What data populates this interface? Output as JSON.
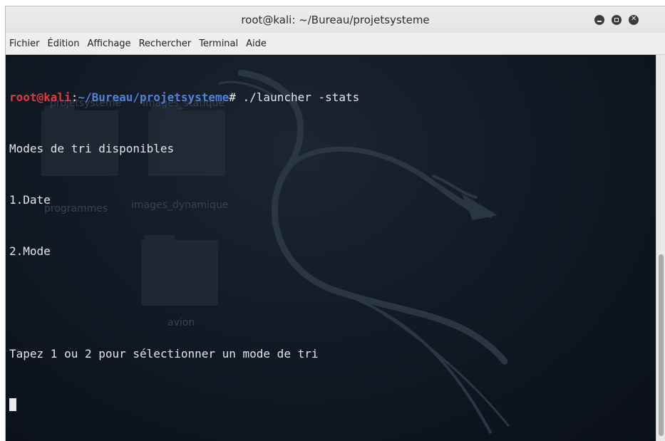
{
  "window": {
    "title": "root@kali: ~/Bureau/projetsysteme"
  },
  "menu": [
    {
      "label": "Fichier"
    },
    {
      "label": "Édition"
    },
    {
      "label": "Affichage"
    },
    {
      "label": "Rechercher"
    },
    {
      "label": "Terminal"
    },
    {
      "label": "Aide"
    }
  ],
  "terminal": {
    "prompt_user": "root@kali",
    "prompt_colon": ":",
    "prompt_path": "~/Bureau/projetsysteme",
    "prompt_symbol": "# ",
    "command": "./launcher -stats",
    "output": [
      "Modes de tri disponibles",
      "1.Date",
      "2.Mode",
      "",
      "Tapez 1 ou 2 pour sélectionner un mode de tri"
    ]
  },
  "desktop_icons": [
    {
      "label": "projetsysteme"
    },
    {
      "label": "images_statique"
    },
    {
      "label": "programmes"
    },
    {
      "label": "images_dynamique"
    },
    {
      "label": "avion"
    }
  ],
  "colors": {
    "prompt_user": "#e0383e",
    "prompt_path": "#4f82d6",
    "terminal_bg": "#111a25",
    "text": "#e6e6e6"
  }
}
